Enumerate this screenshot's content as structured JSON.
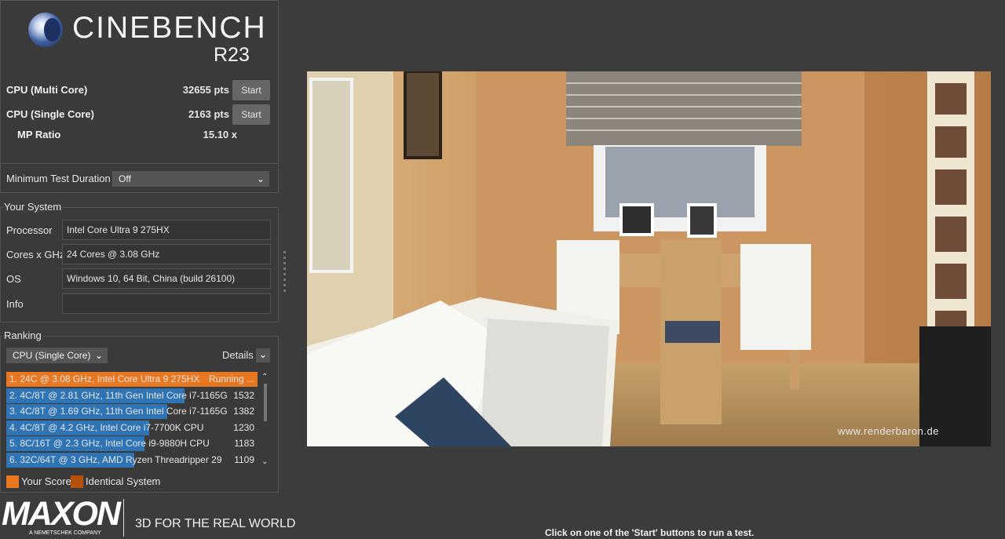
{
  "header": {
    "brand": "CINEBENCH",
    "version": "R23"
  },
  "tests": [
    {
      "label": "CPU (Multi Core)",
      "score": "32655 pts",
      "button": "Start"
    },
    {
      "label": "CPU (Single Core)",
      "score": "2163 pts",
      "button": "Start"
    },
    {
      "label": "MP Ratio",
      "score": "15.10 x"
    }
  ],
  "minimum_test_duration": {
    "label": "Minimum Test Duration",
    "value": "Off"
  },
  "your_system": {
    "title": "Your System",
    "fields": [
      {
        "label": "Processor",
        "value": "Intel Core Ultra 9 275HX"
      },
      {
        "label": "Cores x GHz",
        "value": "24 Cores @ 3.08 GHz"
      },
      {
        "label": "OS",
        "value": "Windows 10, 64 Bit, China (build 26100)"
      },
      {
        "label": "Info",
        "value": ""
      }
    ]
  },
  "ranking": {
    "title": "Ranking",
    "selected": "CPU (Single Core)",
    "details": "Details",
    "rows": [
      {
        "text": "1. 24C @ 3.08 GHz, Intel Core Ultra 9 275HX",
        "score": "Running ...",
        "fill": 1.0,
        "color": "#e87722"
      },
      {
        "text": "2. 4C/8T @ 2.81 GHz, 11th Gen Intel Core i7-1165G",
        "score": "1532",
        "fill": 0.71,
        "color": "#2f74b5"
      },
      {
        "text": "3. 4C/8T @ 1.69 GHz, 11th Gen Intel Core i7-1165G",
        "score": "1382",
        "fill": 0.64,
        "color": "#2f74b5"
      },
      {
        "text": "4. 4C/8T @ 4.2 GHz, Intel Core i7-7700K CPU",
        "score": "1230",
        "fill": 0.57,
        "color": "#2f74b5"
      },
      {
        "text": "5. 8C/16T @ 2.3 GHz, Intel Core i9-9880H CPU",
        "score": "1183",
        "fill": 0.55,
        "color": "#2f74b5"
      },
      {
        "text": "6. 32C/64T @ 3 GHz, AMD Ryzen Threadripper 29",
        "score": "1109",
        "fill": 0.51,
        "color": "#2f74b5"
      }
    ],
    "legend": [
      {
        "label": "Your Score",
        "color": "#e87722"
      },
      {
        "label": "Identical System",
        "color": "#b5510d"
      }
    ]
  },
  "footer": {
    "maxon": "MAXON",
    "maxon_sub": "A NEMETSCHEK COMPANY",
    "tagline": "3D FOR THE REAL WORLD"
  },
  "render": {
    "watermark": "www.renderbaron.de"
  },
  "status": "Click on one of the 'Start' buttons to run a test."
}
